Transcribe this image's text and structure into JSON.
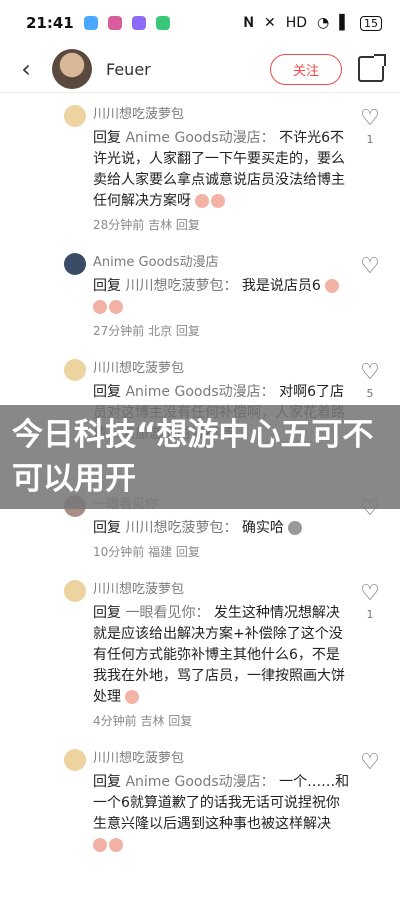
{
  "status": {
    "time": "21:41",
    "battery": "15"
  },
  "header": {
    "user_name": "Feuer",
    "follow_label": "关注"
  },
  "comments": [
    {
      "name": "川川想吃菠萝包",
      "reply": "回复",
      "target": "Anime Goods动漫店：",
      "text": "不许光6不许光说，人家翻了一下午要买走的，要么卖给人家要么拿点诚意说店员没法给博主任何解决方案呀",
      "meta": "28分钟前  吉林  回复",
      "likes": "1"
    },
    {
      "name": "Anime Goods动漫店",
      "reply": "回复",
      "target": "川川想吃菠萝包：",
      "text": "我是说店员6",
      "meta": "27分钟前  北京  回复",
      "likes": ""
    },
    {
      "name": "川川想吃菠萝包",
      "reply": "回复",
      "target": "Anime Goods动漫店：",
      "text": "对啊6了店员对这博主没有任何补偿啊，人家花着路费，来旅游的时候都特",
      "meta": "",
      "likes": "5"
    },
    {
      "name": "一眼看见你",
      "reply": "回复",
      "target": "川川想吃菠萝包：",
      "text": "确实哈",
      "meta": "10分钟前  福建  回复",
      "likes": ""
    },
    {
      "name": "川川想吃菠萝包",
      "reply": "回复",
      "target": "一眼看见你：",
      "text": "发生这种情况想解决就是应该给出解决方案+补偿除了这个没有任何方式能弥补博主其他什么6，不是我我在外地，骂了店员，一律按照画大饼处理",
      "meta": "4分钟前  吉林  回复",
      "likes": "1"
    },
    {
      "name": "川川想吃菠萝包",
      "reply": "回复",
      "target": "Anime Goods动漫店：",
      "text": "一个……和一个6就算道歉了的话我无话可说捏祝你生意兴隆以后遇到这种事也被这样解决",
      "meta": "",
      "likes": ""
    }
  ],
  "banner": {
    "text": "今日科技“想游中心五可不可以用开"
  }
}
